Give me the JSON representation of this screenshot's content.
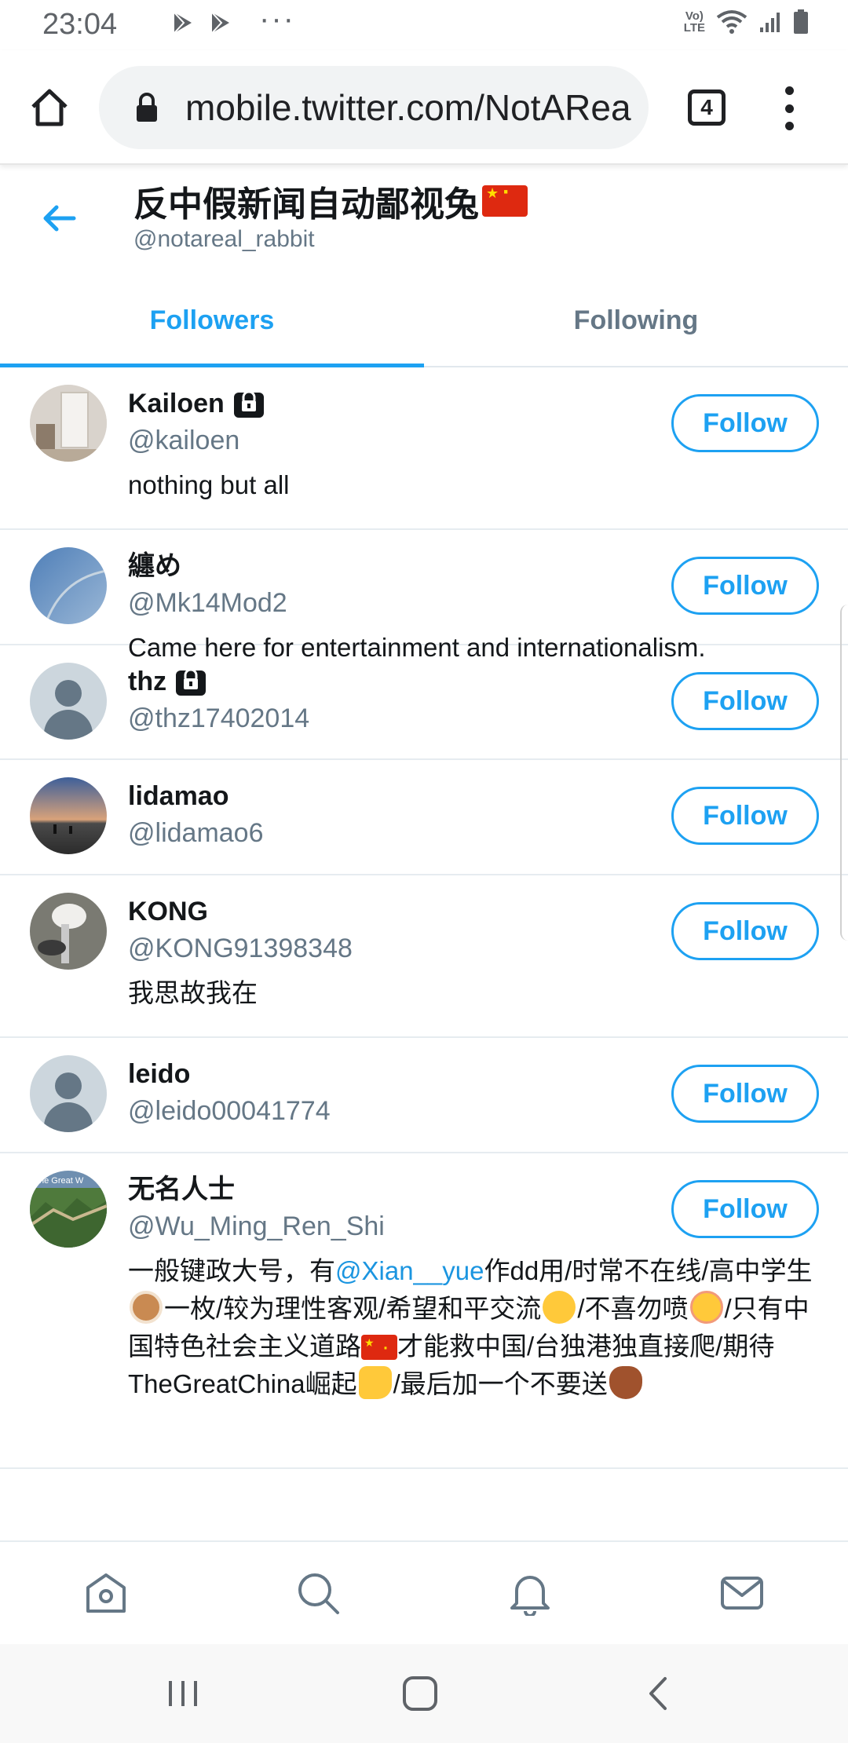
{
  "status_bar": {
    "time": "23:04",
    "dots": "···",
    "network_label": "Vo) LTE"
  },
  "browser": {
    "url": "mobile.twitter.com/NotARea",
    "tab_count": "4"
  },
  "profile": {
    "name": "反中假新闻自动鄙视兔",
    "handle": "@notareal_rabbit"
  },
  "tabs": [
    {
      "label": "Followers",
      "active": true
    },
    {
      "label": "Following",
      "active": false
    }
  ],
  "follow_label": "Follow",
  "users": [
    {
      "name": "Kailoen",
      "handle": "@kailoen",
      "bio": "nothing but all",
      "protected": true
    },
    {
      "name": "纏め",
      "handle": "@Mk14Mod2",
      "bio": "Came here for entertainment and internationalism.",
      "protected": false
    },
    {
      "name": "thz",
      "handle": "@thz17402014",
      "bio": "",
      "protected": true
    },
    {
      "name": "lidamao",
      "handle": "@lidamao6",
      "bio": "",
      "protected": false
    },
    {
      "name": "KONG",
      "handle": "@KONG91398348",
      "bio": "我思故我在",
      "protected": false
    },
    {
      "name": "leido",
      "handle": "@leido00041774",
      "bio": "",
      "protected": false
    },
    {
      "name": "无名人士",
      "handle": "@Wu_Ming_Ren_Shi",
      "protected": false,
      "bio_parts": {
        "p1": "一般键政大号，有",
        "mention": "@Xian__yue",
        "p2": "作dd用/时常不在线/高中学生",
        "p3": "一枚/较为理性客观/希望和平交流",
        "p4": "/不喜勿喷",
        "p5": "/只有中国特色社会主义道路",
        "p6": "才能救中国/台独港独直接爬/期待TheGreatChina崛起",
        "p7": "/最后加一个不要送"
      },
      "avatar_caption": "he Great W"
    }
  ],
  "bottom_nav": [
    "home-icon",
    "search-icon",
    "notifications-icon",
    "messages-icon"
  ],
  "colors": {
    "accent": "#1da1f2",
    "secondary_text": "#657786",
    "divider": "#e6ecf0"
  }
}
